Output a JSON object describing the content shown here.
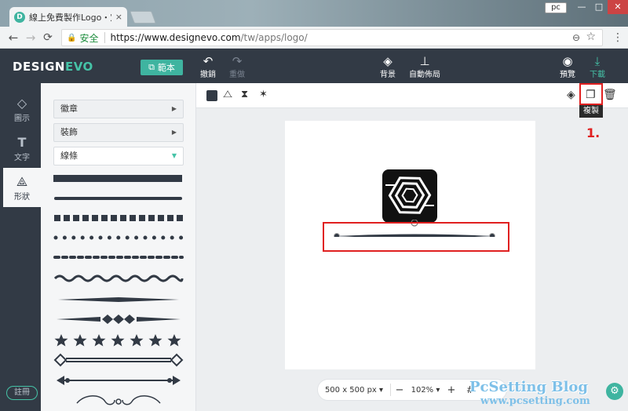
{
  "browser": {
    "tab_title": "線上免費製作Logo・定制",
    "tab_favicon": "D",
    "tab_close": "×",
    "user": "pc",
    "window_buttons": {
      "min": "—",
      "max": "□",
      "close": "✕"
    },
    "nav": {
      "back": "←",
      "forward": "→",
      "reload": "C"
    },
    "secure_label": "安全",
    "url_host": "https://www.designevo.com",
    "url_path": "/tw/apps/logo/"
  },
  "app": {
    "logo_design": "DESIGN",
    "logo_evo": "EVO",
    "template_button": "範本",
    "toolbar": {
      "undo": "撤銷",
      "redo": "重做",
      "background": "背景",
      "auto_layout": "自動佈局",
      "preview": "預覽",
      "download": "下載"
    }
  },
  "rail": {
    "items": [
      {
        "label": "圖示",
        "icon": "gem-icon"
      },
      {
        "label": "文字",
        "icon": "text-icon"
      },
      {
        "label": "形狀",
        "icon": "shapes-icon"
      }
    ],
    "register": "註冊"
  },
  "panel": {
    "categories": [
      {
        "label": "徽章",
        "state": "collapsed"
      },
      {
        "label": "裝飾",
        "state": "collapsed"
      },
      {
        "label": "線條",
        "state": "expanded"
      }
    ]
  },
  "context": {
    "copy_tooltip": "複製",
    "annotation": "1."
  },
  "zoom": {
    "size": "500 x 500 px",
    "percent": "102%",
    "minus": "−",
    "plus": "+"
  },
  "watermark": {
    "title": "PcSetting Blog",
    "url": "www.pcsetting.com"
  },
  "colors": {
    "header": "#323a45",
    "accent": "#3fb4a0",
    "annotation": "#e02020"
  }
}
